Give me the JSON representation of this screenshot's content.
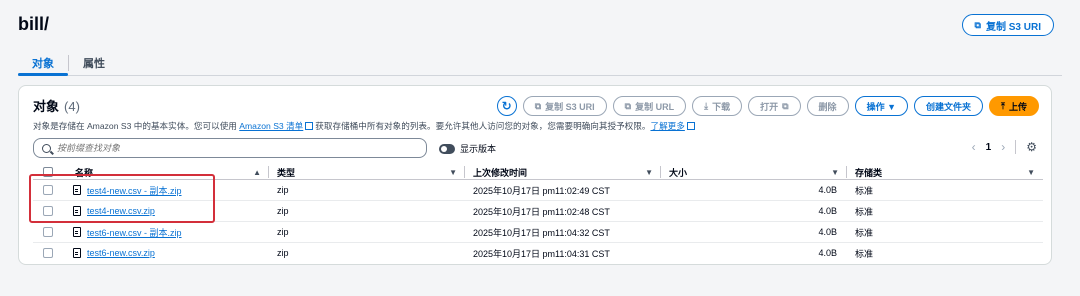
{
  "page": {
    "title": "bill/",
    "copy_uri_label": "复制 S3 URI"
  },
  "tabs": [
    {
      "label": "对象",
      "active": true
    },
    {
      "label": "属性",
      "active": false
    }
  ],
  "panel": {
    "title": "对象",
    "count": "(4)",
    "description_pre": "对象是存储在 Amazon S3 中的基本实体。您可以使用 ",
    "description_link1": "Amazon S3 清单",
    "description_mid": "获取存储桶中所有对象的列表。要允许其他人访问您的对象，您需要明确向其授予权限。",
    "description_link2": "了解更多"
  },
  "toolbar": {
    "copy_uri": "复制 S3 URI",
    "copy_url": "复制 URL",
    "download": "下载",
    "open": "打开",
    "delete": "删除",
    "actions": "操作 ▼",
    "create_folder": "创建文件夹",
    "upload": "上传"
  },
  "search": {
    "placeholder": "按前缀查找对象"
  },
  "toggle": {
    "label": "显示版本"
  },
  "pager": {
    "page": "1"
  },
  "table": {
    "headers": [
      "名称",
      "类型",
      "上次修改时间",
      "大小",
      "存储类"
    ],
    "rows": [
      {
        "name": "test4-new.csv - 副本.zip",
        "type": "zip",
        "modified": "2025年10月17日 pm11:02:49 CST",
        "size": "4.0B",
        "storage": "标准"
      },
      {
        "name": "test4-new.csv.zip",
        "type": "zip",
        "modified": "2025年10月17日 pm11:02:48 CST",
        "size": "4.0B",
        "storage": "标准"
      },
      {
        "name": "test6-new.csv - 副本.zip",
        "type": "zip",
        "modified": "2025年10月17日 pm11:04:32 CST",
        "size": "4.0B",
        "storage": "标准"
      },
      {
        "name": "test6-new.csv.zip",
        "type": "zip",
        "modified": "2025年10月17日 pm11:04:31 CST",
        "size": "4.0B",
        "storage": "标准"
      }
    ]
  },
  "colors": {
    "accent": "#0972d3",
    "primary": "#ff9900",
    "highlight": "#d32f3a"
  }
}
